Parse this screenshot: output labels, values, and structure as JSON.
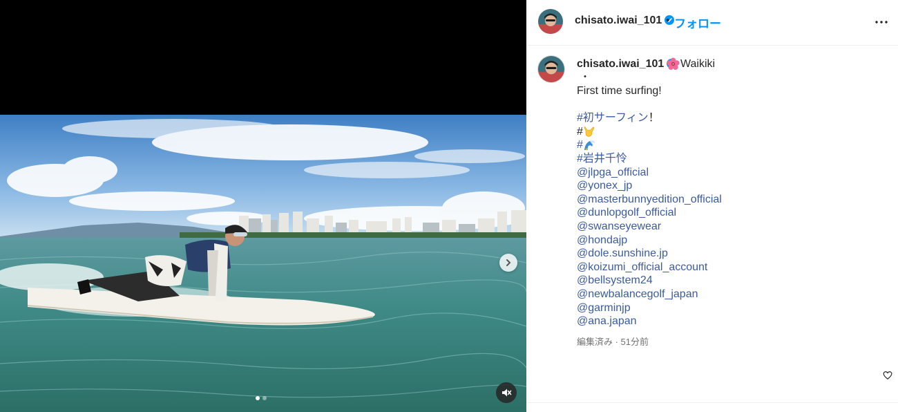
{
  "post": {
    "username": "chisato.iwai_101",
    "follow_label": "フォロー",
    "location": "Waikiki",
    "caption": {
      "bullet": "・",
      "first_line": "First time surfing!",
      "hashtag_1": "#初サーフィン",
      "hashtag_1_suffix": "！",
      "hashtag_2": "#",
      "hashtag_3": "#",
      "hashtag_4": "#岩井千怜",
      "mentions": [
        "@jlpga_official",
        "@yonex_jp",
        "@masterbunnyedition_official",
        "@dunlopgolf_official",
        "@swanseyewear",
        "@hondajp",
        "@dole.sunshine.jp",
        "@koizumi_official_account",
        "@bellsystem24",
        "@newbalancegolf_japan",
        "@garminjp",
        "@ana.japan"
      ]
    },
    "meta": "編集済み · 51分前"
  },
  "icons": {
    "verified": "verified-badge-icon",
    "more": "more-options-icon",
    "next": "chevron-right-icon",
    "mute": "muted-speaker-icon",
    "heart": "heart-icon",
    "flower": "hibiscus-emoji",
    "shaka": "shaka-hand-emoji",
    "wave": "wave-emoji"
  },
  "carousel": {
    "slides": 2,
    "current": 1
  },
  "colors": {
    "link": "#3a5b9f",
    "follow": "#0095f6",
    "verified": "#0095f6",
    "meta": "#737373"
  }
}
